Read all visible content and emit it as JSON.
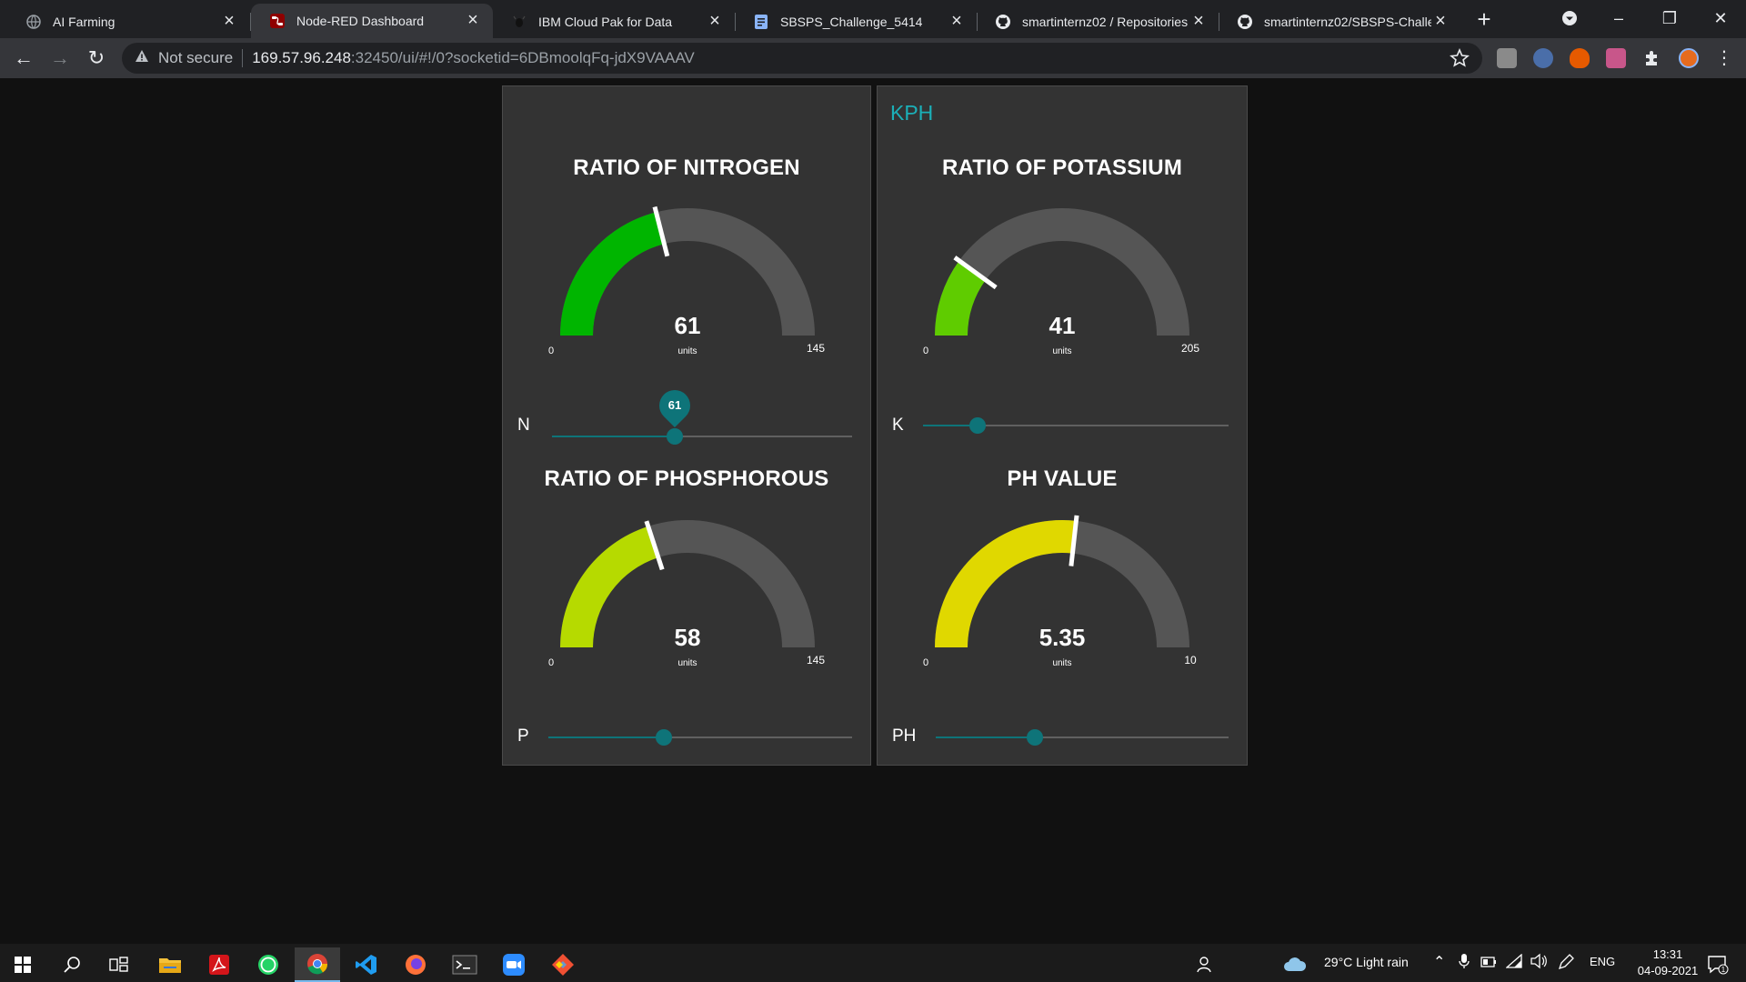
{
  "browser": {
    "tabs": [
      {
        "title": "AI Farming",
        "icon": "globe-icon",
        "active": false
      },
      {
        "title": "Node-RED Dashboard",
        "icon": "node-red-icon",
        "active": true
      },
      {
        "title": "IBM Cloud Pak for Data",
        "icon": "ibm-bee-icon",
        "active": false
      },
      {
        "title": "SBSPS_Challenge_5414",
        "icon": "document-icon",
        "active": false
      },
      {
        "title": "smartinternz02 / Repositories",
        "icon": "github-icon",
        "active": false
      },
      {
        "title": "smartinternz02/SBSPS-Challenge",
        "icon": "github-icon",
        "active": false
      }
    ],
    "security_label": "Not secure",
    "url_host": "169.57.96.248",
    "url_rest": ":32450/ui/#!/0?socketid=6DBmoolqFq-jdX9VAAAV"
  },
  "dashboard": {
    "group_right_title": "KPH",
    "gauges": [
      {
        "title": "RATIO OF NITROGEN",
        "value": 61,
        "display": "61",
        "min": 0,
        "max": 145,
        "min_label": "0",
        "max_label": "145",
        "units": "units",
        "color": "#00b500"
      },
      {
        "title": "RATIO OF POTASSIUM",
        "value": 41,
        "display": "41",
        "min": 0,
        "max": 205,
        "min_label": "0",
        "max_label": "205",
        "units": "units",
        "color": "#5fcc00"
      },
      {
        "title": "RATIO OF PHOSPHOROUS",
        "value": 58,
        "display": "58",
        "min": 0,
        "max": 145,
        "min_label": "0",
        "max_label": "145",
        "units": "units",
        "color": "#b6da00"
      },
      {
        "title": "PH VALUE",
        "value": 5.35,
        "display": "5.35",
        "min": 0,
        "max": 10,
        "min_label": "0",
        "max_label": "10",
        "units": "units",
        "color": "#e0d800"
      }
    ],
    "sliders": [
      {
        "label": "N",
        "fraction": 0.41,
        "bubble": "61"
      },
      {
        "label": "K",
        "fraction": 0.18
      },
      {
        "label": "P",
        "fraction": 0.38
      },
      {
        "label": "PH",
        "fraction": 0.34
      }
    ],
    "gauge_background_color": "#555555",
    "accent_color": "#0e7479"
  },
  "taskbar": {
    "weather": "29°C  Light rain",
    "language": "ENG",
    "time": "13:31",
    "date": "04-09-2021",
    "notification_count": "1"
  }
}
